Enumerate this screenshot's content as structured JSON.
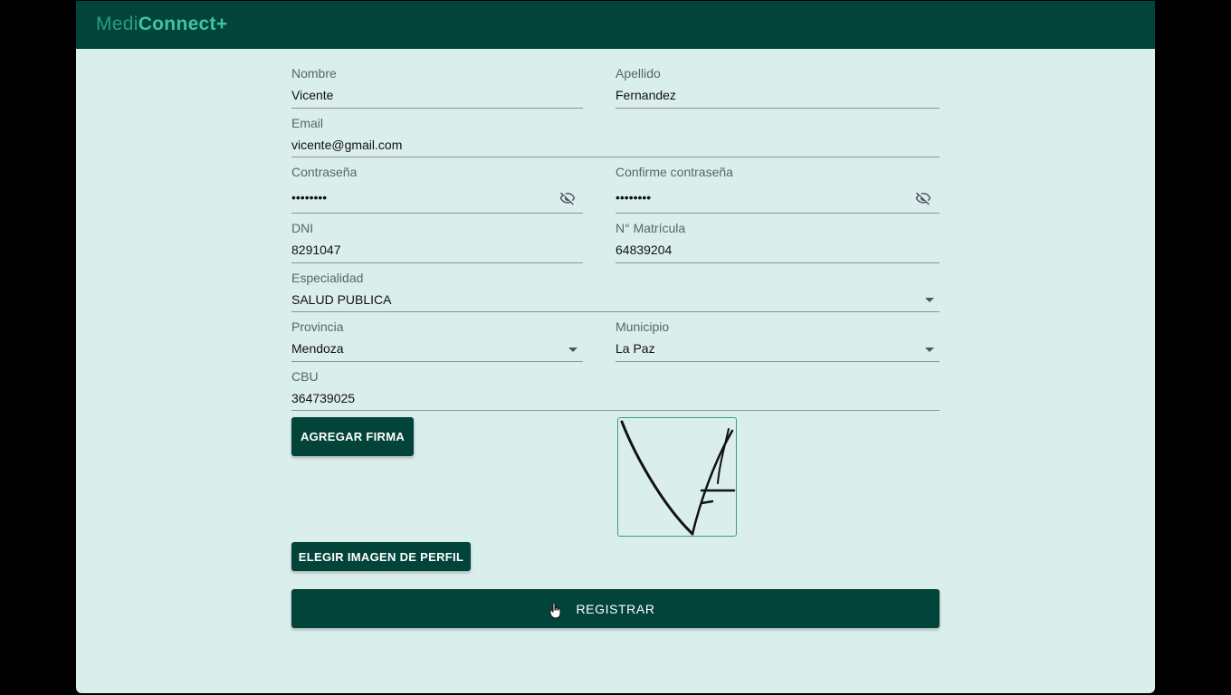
{
  "brand": {
    "part1": "Medi",
    "part2": "Connect+"
  },
  "form": {
    "nombre": {
      "label": "Nombre",
      "value": "Vicente"
    },
    "apellido": {
      "label": "Apellido",
      "value": "Fernandez"
    },
    "email": {
      "label": "Email",
      "value": "vicente@gmail.com"
    },
    "contrasena": {
      "label": "Contraseña",
      "value": "••••••••",
      "icon": "eye-off-icon"
    },
    "confirme": {
      "label": "Confirme contraseña",
      "value": "••••••••",
      "icon": "eye-off-icon"
    },
    "dni": {
      "label": "DNI",
      "value": "8291047"
    },
    "matricula": {
      "label": "N° Matrícula",
      "value": "64839204"
    },
    "especialidad": {
      "label": "Especialidad",
      "value": "SALUD PUBLICA"
    },
    "provincia": {
      "label": "Provincia",
      "value": "Mendoza"
    },
    "municipio": {
      "label": "Municipio",
      "value": "La Paz"
    },
    "cbu": {
      "label": "CBU",
      "value": "364739025"
    }
  },
  "buttons": {
    "agregar_firma": "AGREGAR FIRMA",
    "elegir_imagen": "ELEGIR IMAGEN DE PERFIL",
    "registrar": "REGISTRAR"
  },
  "colors": {
    "primary": "#02443a",
    "background": "#daeeec",
    "accent": "#3fc4a2"
  }
}
